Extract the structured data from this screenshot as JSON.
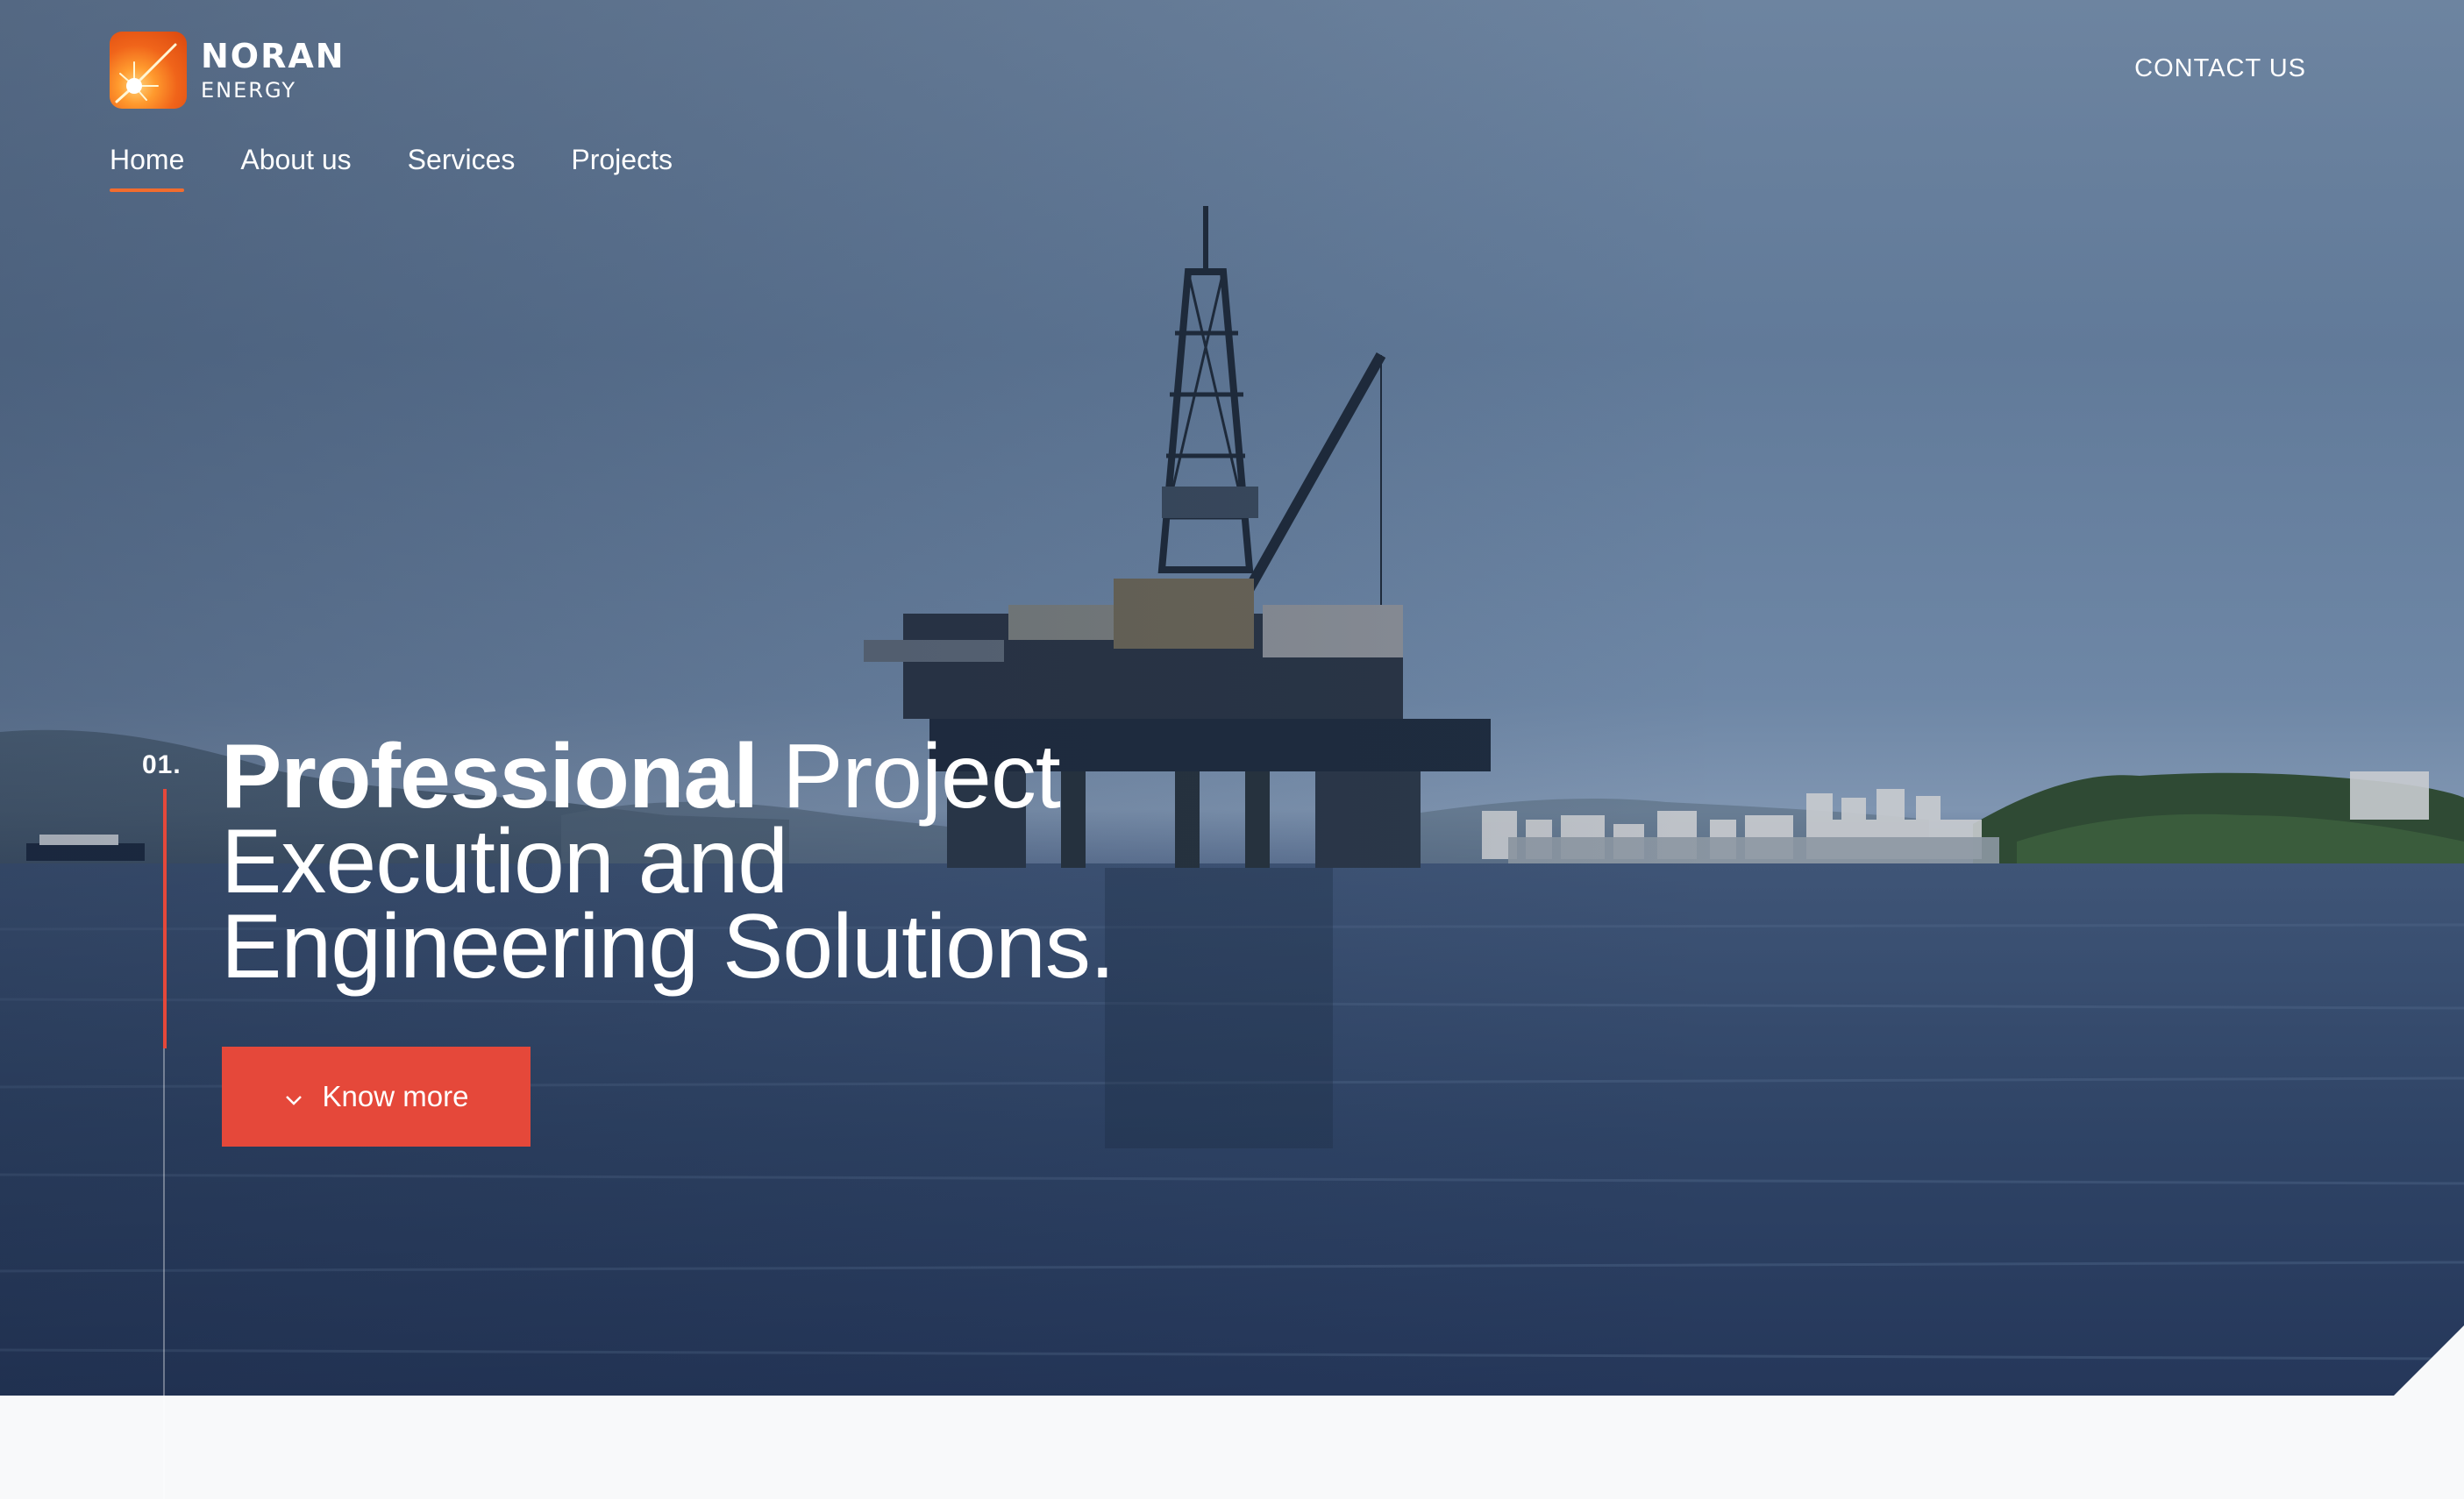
{
  "brand": {
    "name": "NORAN",
    "sub": "ENERGY"
  },
  "header": {
    "contact_label": "CONTACT US"
  },
  "nav": {
    "items": [
      {
        "label": "Home",
        "active": true
      },
      {
        "label": "About us",
        "active": false
      },
      {
        "label": "Services",
        "active": false
      },
      {
        "label": "Projects",
        "active": false
      }
    ]
  },
  "hero": {
    "slide_number": "01.",
    "headline_bold": "Professional",
    "headline_rest_1": " Project",
    "headline_line_2": "Execution and",
    "headline_line_3": "Engineering Solutions.",
    "cta_label": "Know more",
    "cta_icon": "chevron-down-icon",
    "background_image": "offshore-oil-rig-at-sea"
  },
  "colors": {
    "accent": "#e5483a",
    "nav_underline": "#f36c2d",
    "page_background": "#f8f9fa"
  }
}
